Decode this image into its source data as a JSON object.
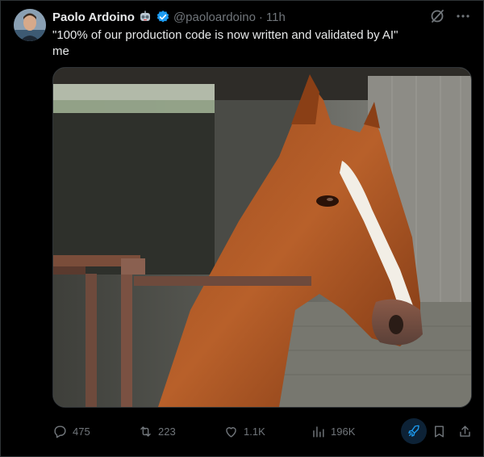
{
  "author": {
    "name": "Paolo Ardoino",
    "handle": "@paoloardoino",
    "separator": "·",
    "time": "11h",
    "badge_icon": "robot-emoji-icon",
    "verified_icon": "verified-badge-icon",
    "verified_color": "#1d9bf0"
  },
  "tweet": {
    "line1": "\"100% of our production code is now written and validated by AI\"",
    "line2": "me"
  },
  "media": {
    "image_icon": "horse-photo"
  },
  "actions": {
    "replies": "475",
    "reposts": "223",
    "likes": "1.1K",
    "views": "196K"
  },
  "colors": {
    "background": "#000000",
    "text": "#e7e9ea",
    "muted": "#71767b",
    "accent": "#1d9bf0",
    "grok_bg": "#0d2236"
  }
}
